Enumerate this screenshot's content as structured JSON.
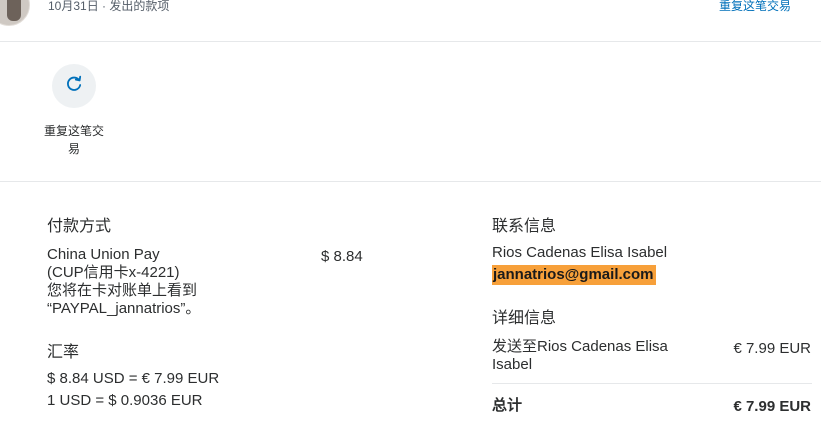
{
  "header": {
    "date_text": "10月31日 · 发出的款项",
    "repeat_link": "重复这笔交易"
  },
  "actions": {
    "repeat_label": "重复这笔交易",
    "repeat_icon": "refresh-icon"
  },
  "payment_method": {
    "title": "付款方式",
    "line1": "China Union Pay",
    "line2": "(CUP信用卡x-4221)",
    "line3": "您将在卡对账单上看到",
    "line4": "“PAYPAL_jannatrios”。",
    "amount": "$ 8.84"
  },
  "exchange_rate": {
    "title": "汇率",
    "line1": "$ 8.84 USD = € 7.99 EUR",
    "line2": "1 USD = $ 0.9036 EUR"
  },
  "contact": {
    "title": "联系信息",
    "name": "Rios Cadenas Elisa Isabel",
    "email": "jannatrios@gmail.com"
  },
  "details": {
    "title": "详细信息",
    "sent_to_line1": "发送至Rios Cadenas Elisa",
    "sent_to_line2": "Isabel",
    "sent_amount": "€ 7.99 EUR",
    "total_label": "总计",
    "total_amount": "€ 7.99 EUR"
  },
  "colors": {
    "link": "#0070ba",
    "highlight": "#f7a03a",
    "text": "#2c2e2f"
  }
}
